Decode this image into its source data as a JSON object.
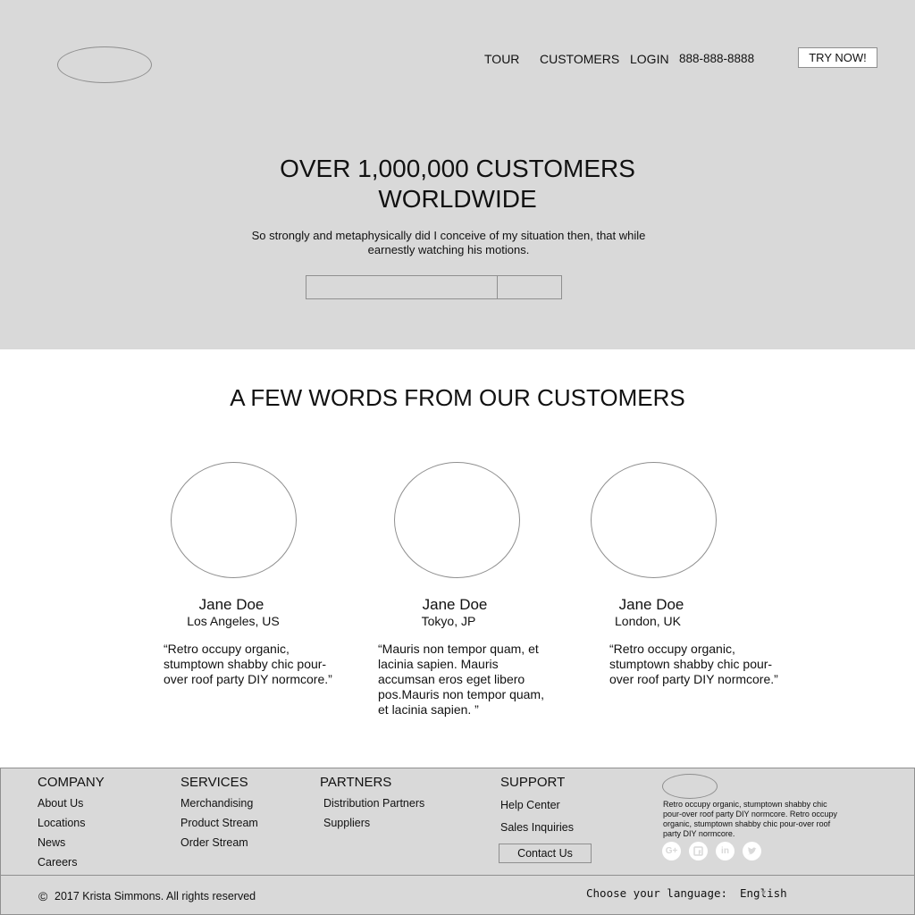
{
  "nav": {
    "items": [
      "TOUR",
      "CUSTOMERS",
      "LOGIN"
    ],
    "phone": "888-888-8888",
    "cta": "TRY NOW!"
  },
  "hero": {
    "title": "OVER 1,000,000 CUSTOMERS WORLDWIDE",
    "subtitle": "So strongly and metaphysically did I conceive of my situation then, that while earnestly watching his motions.",
    "input_value": "",
    "submit_label": ""
  },
  "testimonials": {
    "title": "A FEW WORDS FROM OUR CUSTOMERS",
    "items": [
      {
        "name": "Jane Doe",
        "location": "Los Angeles, US",
        "quote": "“Retro occupy organic, stumptown shabby chic pour-over roof party DIY normcore.”"
      },
      {
        "name": "Jane Doe",
        "location": "Tokyo, JP",
        "quote": "“Mauris non tempor quam, et lacinia sapien. Mauris accumsan eros eget libero pos.Mauris non tempor quam, et lacinia sapien. ”"
      },
      {
        "name": "Jane Doe",
        "location": "London, UK",
        "quote": "“Retro occupy organic, stumptown shabby chic pour-over roof party DIY normcore.”"
      }
    ]
  },
  "footer": {
    "company": {
      "heading": "COMPANY",
      "links": [
        "About Us",
        "Locations",
        "News",
        "Careers"
      ]
    },
    "services": {
      "heading": "SERVICES",
      "links": [
        "Merchandising",
        "Product Stream",
        "Order Stream"
      ]
    },
    "partners": {
      "heading": "PARTNERS",
      "links": [
        "Distribution Partners",
        "Suppliers"
      ]
    },
    "support": {
      "heading": "SUPPORT",
      "links": [
        "Help Center",
        "Sales Inquiries"
      ],
      "contact_button": "Contact Us"
    },
    "blurb": "Retro occupy organic, stumptown shabby chic pour-over roof party DIY normcore. Retro occupy organic, stumptown shabby chic pour-over roof party DIY normcore.",
    "social_icons": [
      "google-plus-icon",
      "facebook-icon",
      "linkedin-icon",
      "twitter-icon"
    ],
    "copyright_symbol": "©",
    "copyright": "2017 Krista Simmons. All rights reserved",
    "language_label": "Choose your language:",
    "language_value": "English"
  }
}
